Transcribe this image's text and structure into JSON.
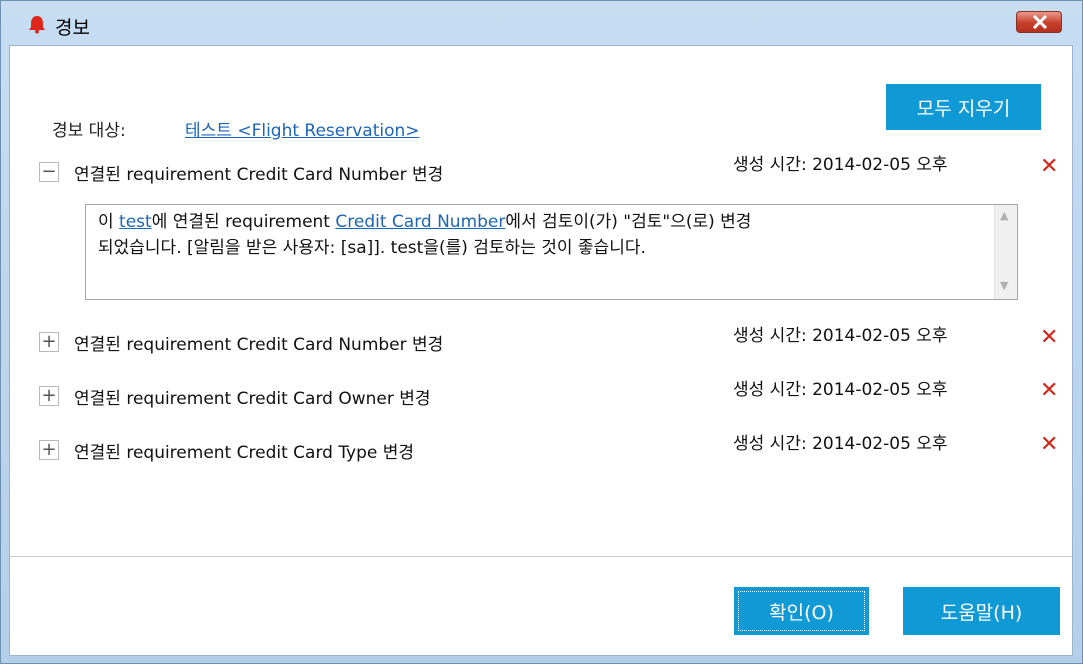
{
  "window": {
    "title": "경보"
  },
  "toolbar": {
    "clear_all_label": "모두 지우기"
  },
  "alert_target": {
    "label": "경보 대상:",
    "link": "테스트 <Flight Reservation>"
  },
  "alerts": [
    {
      "expander": "−",
      "title": "연결된 requirement Credit Card Number 변경",
      "created": "생성 시간: 2014-02-05 오후",
      "expanded": true,
      "detail": {
        "line1_prefix": "이 ",
        "line1_link1": "test",
        "line1_mid": "에 연결된 requirement ",
        "line1_link2": "Credit Card Number",
        "line1_suffix": "에서 검토이(가) \"검토\"으(로) 변경",
        "line2": "되었습니다. [알림을 받은 사용자: [sa]]. test을(를) 검토하는 것이 좋습니다."
      }
    },
    {
      "expander": "+",
      "title": "연결된 requirement Credit Card Number 변경",
      "created": "생성 시간: 2014-02-05 오후",
      "expanded": false
    },
    {
      "expander": "+",
      "title": "연결된 requirement Credit Card Owner 변경",
      "created": "생성 시간: 2014-02-05 오후",
      "expanded": false
    },
    {
      "expander": "+",
      "title": "연결된 requirement Credit Card Type 변경",
      "created": "생성 시간: 2014-02-05 오후",
      "expanded": false
    }
  ],
  "delete_glyph": "✕",
  "footer": {
    "ok_label": "확인(O)",
    "help_label": "도움말(H)"
  },
  "colors": {
    "accent": "#0f9ad6",
    "link": "#1b66b7",
    "delete": "#d0281c"
  },
  "icons": {
    "window": "bell-icon",
    "close": "close-icon",
    "delete": "delete-icon",
    "scroll_up": "scroll-up-arrow-icon",
    "scroll_down": "scroll-down-arrow-icon"
  }
}
